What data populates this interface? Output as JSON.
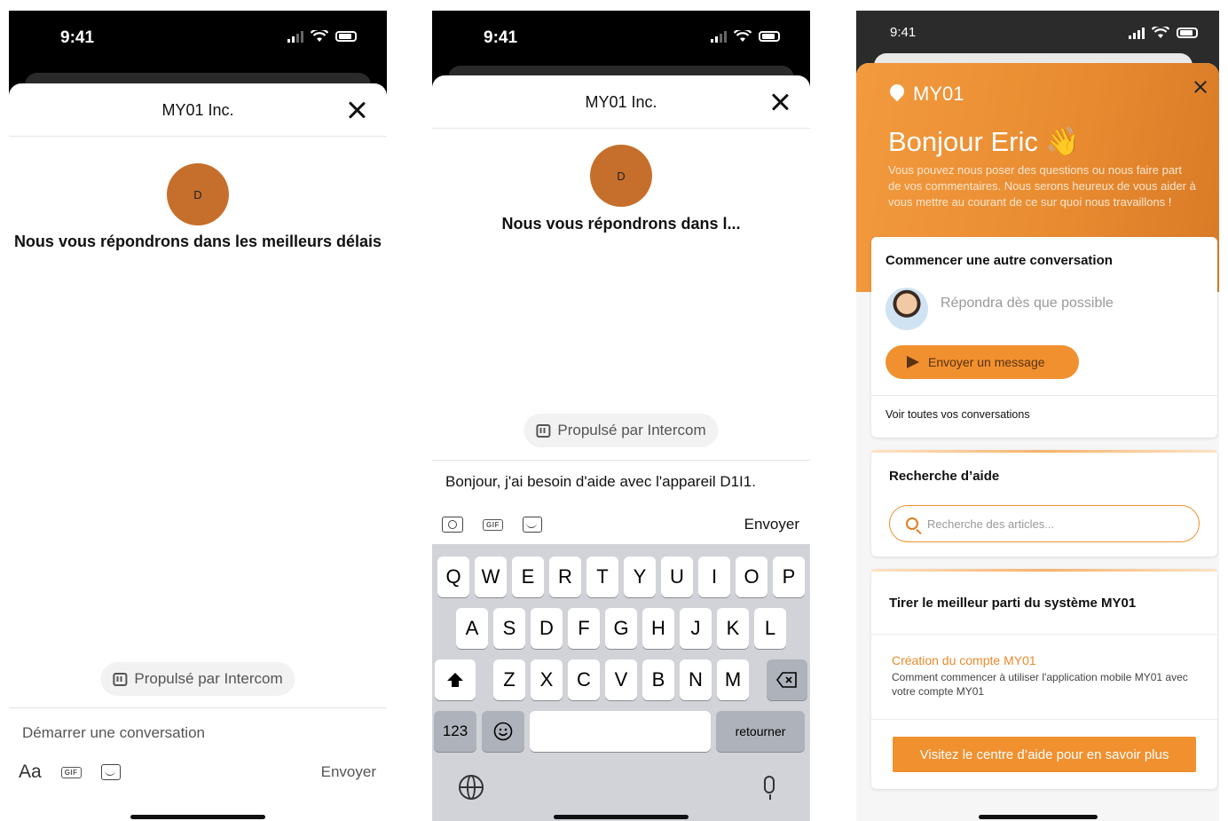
{
  "status_time": "9:41",
  "screen1": {
    "title": "MY01 Inc.",
    "avatar_initial": "D",
    "reply_message": "Nous vous répondrons dans les meilleurs délais",
    "powered_by": "Propulsé par Intercom",
    "composer_placeholder": "Démarrer une conversation",
    "text_format_label": "Aa",
    "gif_label": "GIF",
    "send_label": "Envoyer"
  },
  "screen2": {
    "title": "MY01 Inc.",
    "avatar_initial": "D",
    "reply_message": "Nous vous répondrons dans l...",
    "powered_by": "Propulsé par Intercom",
    "composer_value": "Bonjour, j'ai besoin d'aide avec l'appareil D1I1.",
    "gif_label": "GIF",
    "send_label": "Envoyer",
    "keyboard": {
      "row1": [
        "Q",
        "W",
        "E",
        "R",
        "T",
        "Y",
        "U",
        "I",
        "O",
        "P"
      ],
      "row2": [
        "A",
        "S",
        "D",
        "F",
        "G",
        "H",
        "J",
        "K",
        "L"
      ],
      "row3": [
        "Z",
        "X",
        "C",
        "V",
        "B",
        "N",
        "M"
      ],
      "numbers_key": "123",
      "return_key": "retourner"
    }
  },
  "screen3": {
    "logo_text": "MY01",
    "greeting": "Bonjour Eric 👋",
    "intro": "Vous pouvez nous poser des questions ou nous faire part de vos commentaires. Nous serons heureux de vous aider à vous mettre au courant de ce sur quoi nous travaillons !",
    "new_conversation_title": "Commencer une autre conversation",
    "reply_eta": "Répondra dès que possible",
    "send_message_button": "Envoyer un message",
    "see_all_link": "Voir toutes vos conversations",
    "help_search_title": "Recherche d’aide",
    "search_placeholder": "Recherche des articles...",
    "best_of_title": "Tirer le meilleur parti du système MY01",
    "article_title": "Création du compte MY01",
    "article_description": "Comment commencer à utiliser l'application mobile MY01 avec votre compte MY01",
    "help_center_button": "Visitez le centre d’aide pour en savoir plus"
  },
  "colors": {
    "accent_orange": "#f0902f",
    "avatar_brown": "#c66f2c",
    "keyboard_bg": "#d1d3d9"
  }
}
